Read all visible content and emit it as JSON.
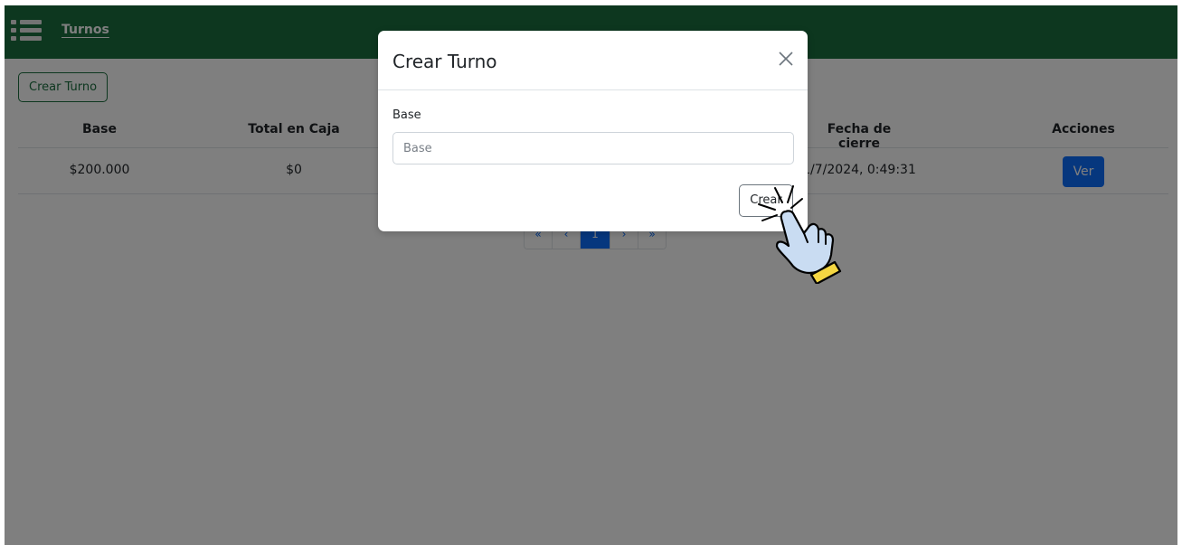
{
  "navbar": {
    "menu_icon": "hamburger-menu-icon",
    "link": "Turnos",
    "color": "#1b6e3f"
  },
  "toolbar": {
    "create_button": "Crear Turno"
  },
  "table": {
    "headers": {
      "base": "Base",
      "total": "Total en Caja",
      "fecha_cierre": "Fecha de cierre",
      "acciones": "Acciones"
    },
    "rows": [
      {
        "base": "$200.000",
        "total": "$0",
        "fecha_cierre": "1/7/2024, 0:49:31",
        "action": "Ver"
      }
    ]
  },
  "pagination": {
    "first": "«",
    "prev": "‹",
    "current": "1",
    "next": "›",
    "last": "»"
  },
  "modal": {
    "title": "Crear Turno",
    "close_icon": "close-icon",
    "field_label": "Base",
    "field_placeholder": "Base",
    "field_value": "",
    "submit_button": "Crear"
  },
  "cursor_icon": "pointer-hand-click-icon",
  "colors": {
    "primary": "#0d6efd",
    "brand_green": "#1b6e3f"
  }
}
